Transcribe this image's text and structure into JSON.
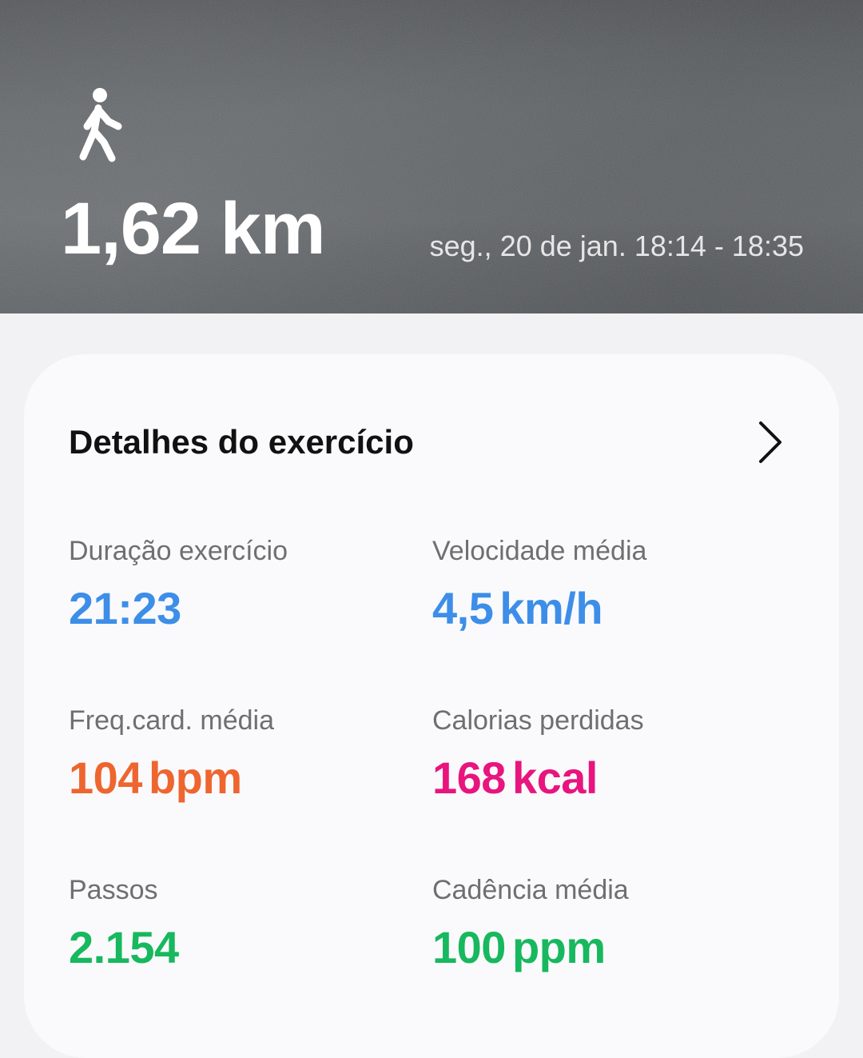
{
  "header": {
    "activity_icon": "walking-person-icon",
    "distance": "1,62 km",
    "date_range": "seg., 20 de jan. 18:14 - 18:35"
  },
  "details": {
    "title": "Detalhes do exercício",
    "more_icon": "chevron-right-icon",
    "metrics": [
      {
        "label": "Duração exercício",
        "value": "21:23",
        "unit": "",
        "color": "#3d8ee8"
      },
      {
        "label": "Velocidade média",
        "value": "4,5",
        "unit": "km/h",
        "color": "#3d8ee8"
      },
      {
        "label": "Freq.card. média",
        "value": "104",
        "unit": "bpm",
        "color": "#ee6530"
      },
      {
        "label": "Calorias perdidas",
        "value": "168",
        "unit": "kcal",
        "color": "#e8157e"
      },
      {
        "label": "Passos",
        "value": "2.154",
        "unit": "",
        "color": "#17b85e"
      },
      {
        "label": "Cadência média",
        "value": "100",
        "unit": "ppm",
        "color": "#17b85e"
      }
    ]
  }
}
